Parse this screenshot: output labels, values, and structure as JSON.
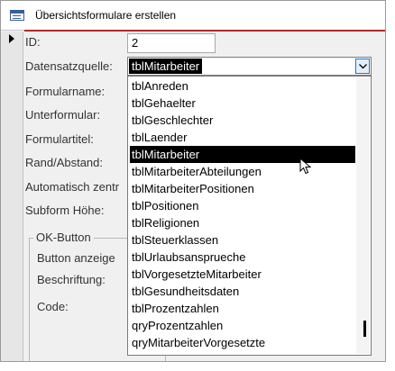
{
  "window": {
    "title": "Übersichtsformulare erstellen"
  },
  "form": {
    "id_label": "ID:",
    "id_value": "2",
    "datasource_label": "Datensatzquelle:",
    "datasource_value": "tblMitarbeiter",
    "formname_label": "Formularname:",
    "subform_label": "Unterformular:",
    "formtitle_label": "Formulartitel:",
    "margin_label": "Rand/Abstand:",
    "autocenter_label": "Automatisch zentr",
    "subform_height_label": "Subform Höhe:"
  },
  "ok_group": {
    "title": "OK-Button",
    "show_label": "Button anzeige",
    "caption_label": "Beschriftung:",
    "code_label": "Code:"
  },
  "dropdown": {
    "selected_index": 4,
    "items": [
      "tblAnreden",
      "tblGehaelter",
      "tblGeschlechter",
      "tblLaender",
      "tblMitarbeiter",
      "tblMitarbeiterAbteilungen",
      "tblMitarbeiterPositionen",
      "tblPositionen",
      "tblReligionen",
      "tblSteuerklassen",
      "tblUrlaubsansprueche",
      "tblVorgesetzteMitarbeiter",
      "tblGesundheitsdaten",
      "tblProzentzahlen",
      "qryProzentzahlen",
      "qryMitarbeiterVorgesetzte"
    ]
  },
  "icons": {
    "form_icon": "form-icon",
    "record_selector": "record-selector-arrow-icon",
    "combo_arrow": "chevron-down-icon",
    "cursor": "mouse-pointer-icon"
  }
}
